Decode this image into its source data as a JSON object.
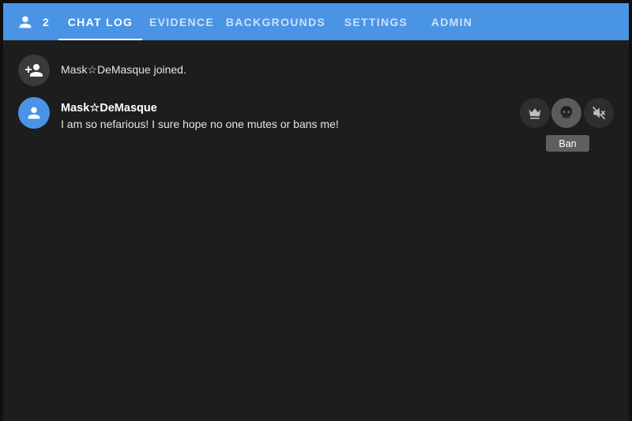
{
  "header": {
    "user_count": "2",
    "tabs": [
      {
        "label": "CHAT LOG",
        "active": true
      },
      {
        "label": "EVIDENCE",
        "active": false
      },
      {
        "label": "BACKGROUNDS",
        "active": false
      },
      {
        "label": "SETTINGS",
        "active": false
      },
      {
        "label": "ADMIN",
        "active": false
      }
    ]
  },
  "chat": {
    "system_message": "Mask☆DeMasque joined.",
    "message": {
      "author": "Mask☆DeMasque",
      "text": "I am so nefarious! I sure hope no one mutes or bans me!"
    },
    "actions": [
      {
        "icon": "crown-icon",
        "label": ""
      },
      {
        "icon": "skull-icon",
        "label": "Ban"
      },
      {
        "icon": "mute-icon",
        "label": ""
      }
    ],
    "tooltip": "Ban"
  },
  "colors": {
    "accent": "#4a94e6",
    "background": "#1d1d1d",
    "action_button": "#2e2e2e",
    "action_button_hover": "#5b5b5b"
  }
}
